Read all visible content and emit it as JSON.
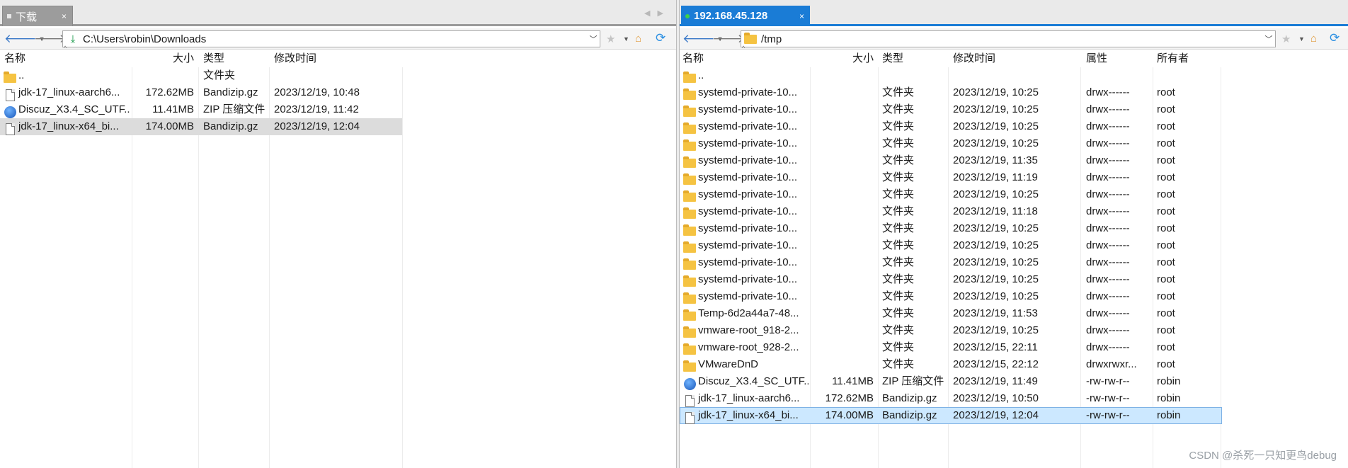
{
  "left": {
    "tab": {
      "label": "下载",
      "close": "×"
    },
    "tab_nav": {
      "prev": "◀",
      "next": "▶"
    },
    "path": "C:\\Users\\robin\\Downloads",
    "columns": {
      "name": "名称",
      "size": "大小",
      "type": "类型",
      "modified": "修改时间"
    },
    "rows": [
      {
        "icon": "folder",
        "name": "..",
        "size": "",
        "type": "文件夹",
        "modified": ""
      },
      {
        "icon": "file",
        "name": "jdk-17_linux-aarch6...",
        "size": "172.62MB",
        "type": "Bandizip.gz",
        "modified": "2023/12/19, 10:48"
      },
      {
        "icon": "zip",
        "name": "Discuz_X3.4_SC_UTF...",
        "size": "11.41MB",
        "type": "ZIP 压缩文件",
        "modified": "2023/12/19, 11:42"
      },
      {
        "icon": "file",
        "name": "jdk-17_linux-x64_bi...",
        "size": "174.00MB",
        "type": "Bandizip.gz",
        "modified": "2023/12/19, 12:04",
        "selected": true
      }
    ]
  },
  "right": {
    "tab": {
      "label": "192.168.45.128",
      "close": "×"
    },
    "path": "/tmp",
    "columns": {
      "name": "名称",
      "size": "大小",
      "type": "类型",
      "modified": "修改时间",
      "attr": "属性",
      "owner": "所有者"
    },
    "rows": [
      {
        "icon": "folder",
        "name": "..",
        "size": "",
        "type": "",
        "modified": "",
        "attr": "",
        "owner": ""
      },
      {
        "icon": "folder",
        "name": "systemd-private-10...",
        "size": "",
        "type": "文件夹",
        "modified": "2023/12/19, 10:25",
        "attr": "drwx------",
        "owner": "root"
      },
      {
        "icon": "folder",
        "name": "systemd-private-10...",
        "size": "",
        "type": "文件夹",
        "modified": "2023/12/19, 10:25",
        "attr": "drwx------",
        "owner": "root"
      },
      {
        "icon": "folder",
        "name": "systemd-private-10...",
        "size": "",
        "type": "文件夹",
        "modified": "2023/12/19, 10:25",
        "attr": "drwx------",
        "owner": "root"
      },
      {
        "icon": "folder",
        "name": "systemd-private-10...",
        "size": "",
        "type": "文件夹",
        "modified": "2023/12/19, 10:25",
        "attr": "drwx------",
        "owner": "root"
      },
      {
        "icon": "folder",
        "name": "systemd-private-10...",
        "size": "",
        "type": "文件夹",
        "modified": "2023/12/19, 11:35",
        "attr": "drwx------",
        "owner": "root"
      },
      {
        "icon": "folder",
        "name": "systemd-private-10...",
        "size": "",
        "type": "文件夹",
        "modified": "2023/12/19, 11:19",
        "attr": "drwx------",
        "owner": "root"
      },
      {
        "icon": "folder",
        "name": "systemd-private-10...",
        "size": "",
        "type": "文件夹",
        "modified": "2023/12/19, 10:25",
        "attr": "drwx------",
        "owner": "root"
      },
      {
        "icon": "folder",
        "name": "systemd-private-10...",
        "size": "",
        "type": "文件夹",
        "modified": "2023/12/19, 11:18",
        "attr": "drwx------",
        "owner": "root"
      },
      {
        "icon": "folder",
        "name": "systemd-private-10...",
        "size": "",
        "type": "文件夹",
        "modified": "2023/12/19, 10:25",
        "attr": "drwx------",
        "owner": "root"
      },
      {
        "icon": "folder",
        "name": "systemd-private-10...",
        "size": "",
        "type": "文件夹",
        "modified": "2023/12/19, 10:25",
        "attr": "drwx------",
        "owner": "root"
      },
      {
        "icon": "folder",
        "name": "systemd-private-10...",
        "size": "",
        "type": "文件夹",
        "modified": "2023/12/19, 10:25",
        "attr": "drwx------",
        "owner": "root"
      },
      {
        "icon": "folder",
        "name": "systemd-private-10...",
        "size": "",
        "type": "文件夹",
        "modified": "2023/12/19, 10:25",
        "attr": "drwx------",
        "owner": "root"
      },
      {
        "icon": "folder",
        "name": "systemd-private-10...",
        "size": "",
        "type": "文件夹",
        "modified": "2023/12/19, 10:25",
        "attr": "drwx------",
        "owner": "root"
      },
      {
        "icon": "folder",
        "name": "Temp-6d2a44a7-48...",
        "size": "",
        "type": "文件夹",
        "modified": "2023/12/19, 11:53",
        "attr": "drwx------",
        "owner": "root"
      },
      {
        "icon": "folder",
        "name": "vmware-root_918-2...",
        "size": "",
        "type": "文件夹",
        "modified": "2023/12/19, 10:25",
        "attr": "drwx------",
        "owner": "root"
      },
      {
        "icon": "folder",
        "name": "vmware-root_928-2...",
        "size": "",
        "type": "文件夹",
        "modified": "2023/12/15, 22:11",
        "attr": "drwx------",
        "owner": "root"
      },
      {
        "icon": "folder",
        "name": "VMwareDnD",
        "size": "",
        "type": "文件夹",
        "modified": "2023/12/15, 22:12",
        "attr": "drwxrwxr...",
        "owner": "root"
      },
      {
        "icon": "zip",
        "name": "Discuz_X3.4_SC_UTF...",
        "size": "11.41MB",
        "type": "ZIP 压缩文件",
        "modified": "2023/12/19, 11:49",
        "attr": "-rw-rw-r--",
        "owner": "robin"
      },
      {
        "icon": "file",
        "name": "jdk-17_linux-aarch6...",
        "size": "172.62MB",
        "type": "Bandizip.gz",
        "modified": "2023/12/19, 10:50",
        "attr": "-rw-rw-r--",
        "owner": "robin"
      },
      {
        "icon": "file",
        "name": "jdk-17_linux-x64_bi...",
        "size": "174.00MB",
        "type": "Bandizip.gz",
        "modified": "2023/12/19, 12:04",
        "attr": "-rw-rw-r--",
        "owner": "robin",
        "selected": true
      }
    ]
  },
  "watermark": "CSDN @杀死一只知更鸟debug",
  "colors": {
    "accent": "#1a7cd6",
    "selection_blue": "#cce8ff",
    "selection_gray": "#dcdcdc",
    "folder": "#f5c342"
  }
}
